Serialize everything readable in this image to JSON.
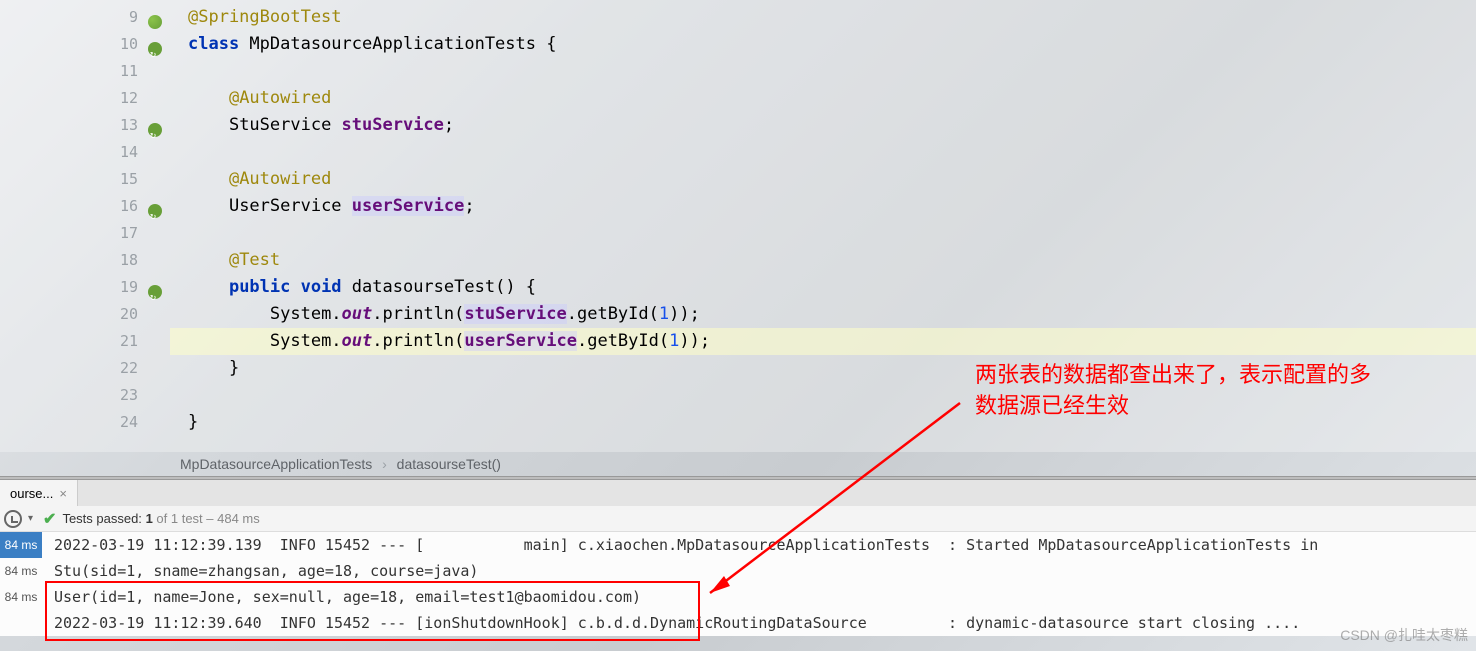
{
  "editor": {
    "lines": [
      {
        "num": 9,
        "icon": "leaf",
        "indent": 0,
        "tokens": [
          {
            "t": "anno",
            "v": "@SpringBootTest"
          }
        ]
      },
      {
        "num": 10,
        "icon": "sync",
        "indent": 0,
        "tokens": [
          {
            "t": "kw",
            "v": "class "
          },
          {
            "t": "type",
            "v": "MpDatasourceApplicationTests "
          },
          {
            "t": "plain",
            "v": "{"
          }
        ]
      },
      {
        "num": 11,
        "icon": "",
        "indent": 0,
        "tokens": []
      },
      {
        "num": 12,
        "icon": "",
        "indent": 1,
        "tokens": [
          {
            "t": "anno",
            "v": "@Autowired"
          }
        ]
      },
      {
        "num": 13,
        "icon": "sync",
        "indent": 1,
        "tokens": [
          {
            "t": "type",
            "v": "StuService "
          },
          {
            "t": "field",
            "v": "stuService"
          },
          {
            "t": "plain",
            "v": ";"
          }
        ]
      },
      {
        "num": 14,
        "icon": "",
        "indent": 0,
        "tokens": []
      },
      {
        "num": 15,
        "icon": "",
        "indent": 1,
        "tokens": [
          {
            "t": "anno",
            "v": "@Autowired"
          }
        ]
      },
      {
        "num": 16,
        "icon": "sync",
        "indent": 1,
        "tokens": [
          {
            "t": "type",
            "v": "UserService "
          },
          {
            "t": "field-warn",
            "v": "userService"
          },
          {
            "t": "plain",
            "v": ";"
          }
        ]
      },
      {
        "num": 17,
        "icon": "",
        "indent": 0,
        "tokens": []
      },
      {
        "num": 18,
        "icon": "",
        "indent": 1,
        "tokens": [
          {
            "t": "anno",
            "v": "@Test"
          }
        ]
      },
      {
        "num": 19,
        "icon": "sync",
        "indent": 1,
        "tokens": [
          {
            "t": "kw",
            "v": "public void "
          },
          {
            "t": "method",
            "v": "datasourseTest"
          },
          {
            "t": "plain",
            "v": "() {"
          }
        ]
      },
      {
        "num": 20,
        "icon": "",
        "indent": 2,
        "tokens": [
          {
            "t": "plain",
            "v": "System."
          },
          {
            "t": "field-italic",
            "v": "out"
          },
          {
            "t": "plain",
            "v": ".println("
          },
          {
            "t": "field-warn",
            "v": "stuService"
          },
          {
            "t": "plain",
            "v": ".getById("
          },
          {
            "t": "num",
            "v": "1"
          },
          {
            "t": "plain",
            "v": "));"
          }
        ]
      },
      {
        "num": 21,
        "icon": "",
        "indent": 2,
        "hl": true,
        "tokens": [
          {
            "t": "plain",
            "v": "System."
          },
          {
            "t": "field-italic",
            "v": "out"
          },
          {
            "t": "plain",
            "v": ".println("
          },
          {
            "t": "field-warn",
            "v": "userService"
          },
          {
            "t": "plain",
            "v": ".getById("
          },
          {
            "t": "num",
            "v": "1"
          },
          {
            "t": "plain",
            "v": "));"
          }
        ]
      },
      {
        "num": 22,
        "icon": "",
        "indent": 1,
        "tokens": [
          {
            "t": "plain",
            "v": "}"
          }
        ]
      },
      {
        "num": 23,
        "icon": "",
        "indent": 0,
        "tokens": []
      },
      {
        "num": 24,
        "icon": "",
        "indent": 0,
        "tokens": [
          {
            "t": "plain",
            "v": "}"
          }
        ]
      }
    ]
  },
  "breadcrumb": {
    "class": "MpDatasourceApplicationTests",
    "method": "datasourseTest()"
  },
  "tab": {
    "label": "ourse..."
  },
  "test_status": {
    "prefix": "Tests passed:",
    "count": "1",
    "of_text": "of 1 test – 484 ms"
  },
  "console": {
    "rows": [
      {
        "badge": "84 ms",
        "active": true,
        "text": "2022-03-19 11:12:39.139  INFO 15452 --- [           main] c.xiaochen.MpDatasourceApplicationTests  : Started MpDatasourceApplicationTests in"
      },
      {
        "badge": "84 ms",
        "active": false,
        "text": "Stu(sid=1, sname=zhangsan, age=18, course=java)"
      },
      {
        "badge": "84 ms",
        "active": false,
        "text": "User(id=1, name=Jone, sex=null, age=18, email=test1@baomidou.com)"
      },
      {
        "badge": "",
        "active": false,
        "text": "2022-03-19 11:12:39.640  INFO 15452 --- [ionShutdownHook] c.b.d.d.DynamicRoutingDataSource         : dynamic-datasource start closing ...."
      }
    ]
  },
  "annotation": {
    "line1": "两张表的数据都查出来了，表示配置的多",
    "line2": "数据源已经生效"
  },
  "watermark": "CSDN @扎哇太枣糕"
}
